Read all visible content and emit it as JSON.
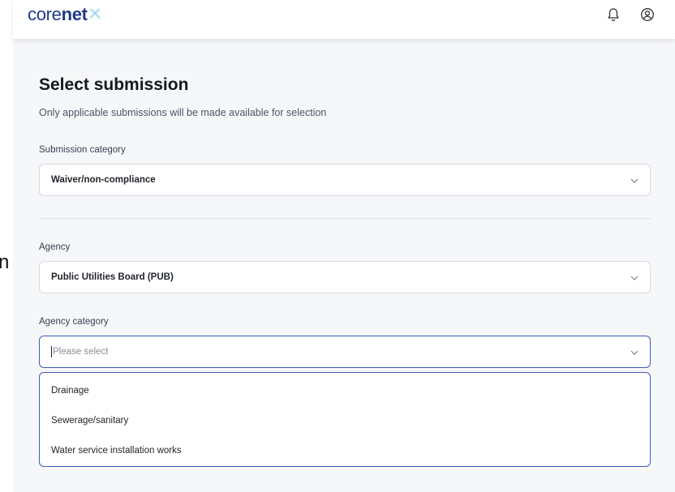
{
  "app": {
    "logo_part1": "core",
    "logo_part2": "net"
  },
  "edge": {
    "glyph": "n"
  },
  "header": {
    "title": "Select submission",
    "subtitle": "Only applicable submissions will be made available for selection"
  },
  "fields": {
    "submission_category": {
      "label": "Submission category",
      "value": "Waiver/non-compliance"
    },
    "agency": {
      "label": "Agency",
      "value": "Public Utilities Board (PUB)"
    },
    "agency_category": {
      "label": "Agency category",
      "placeholder": "Please select",
      "options": [
        "Drainage",
        "Sewerage/sanitary",
        "Water service installation works"
      ]
    }
  },
  "icons": {
    "notification": "bell-icon",
    "account": "user-circle-icon",
    "dropdown": "chevron-down-icon"
  },
  "colors": {
    "brand": "#1f3a8a",
    "focus_border": "#3b5bb8",
    "background": "#f6f7f9"
  }
}
